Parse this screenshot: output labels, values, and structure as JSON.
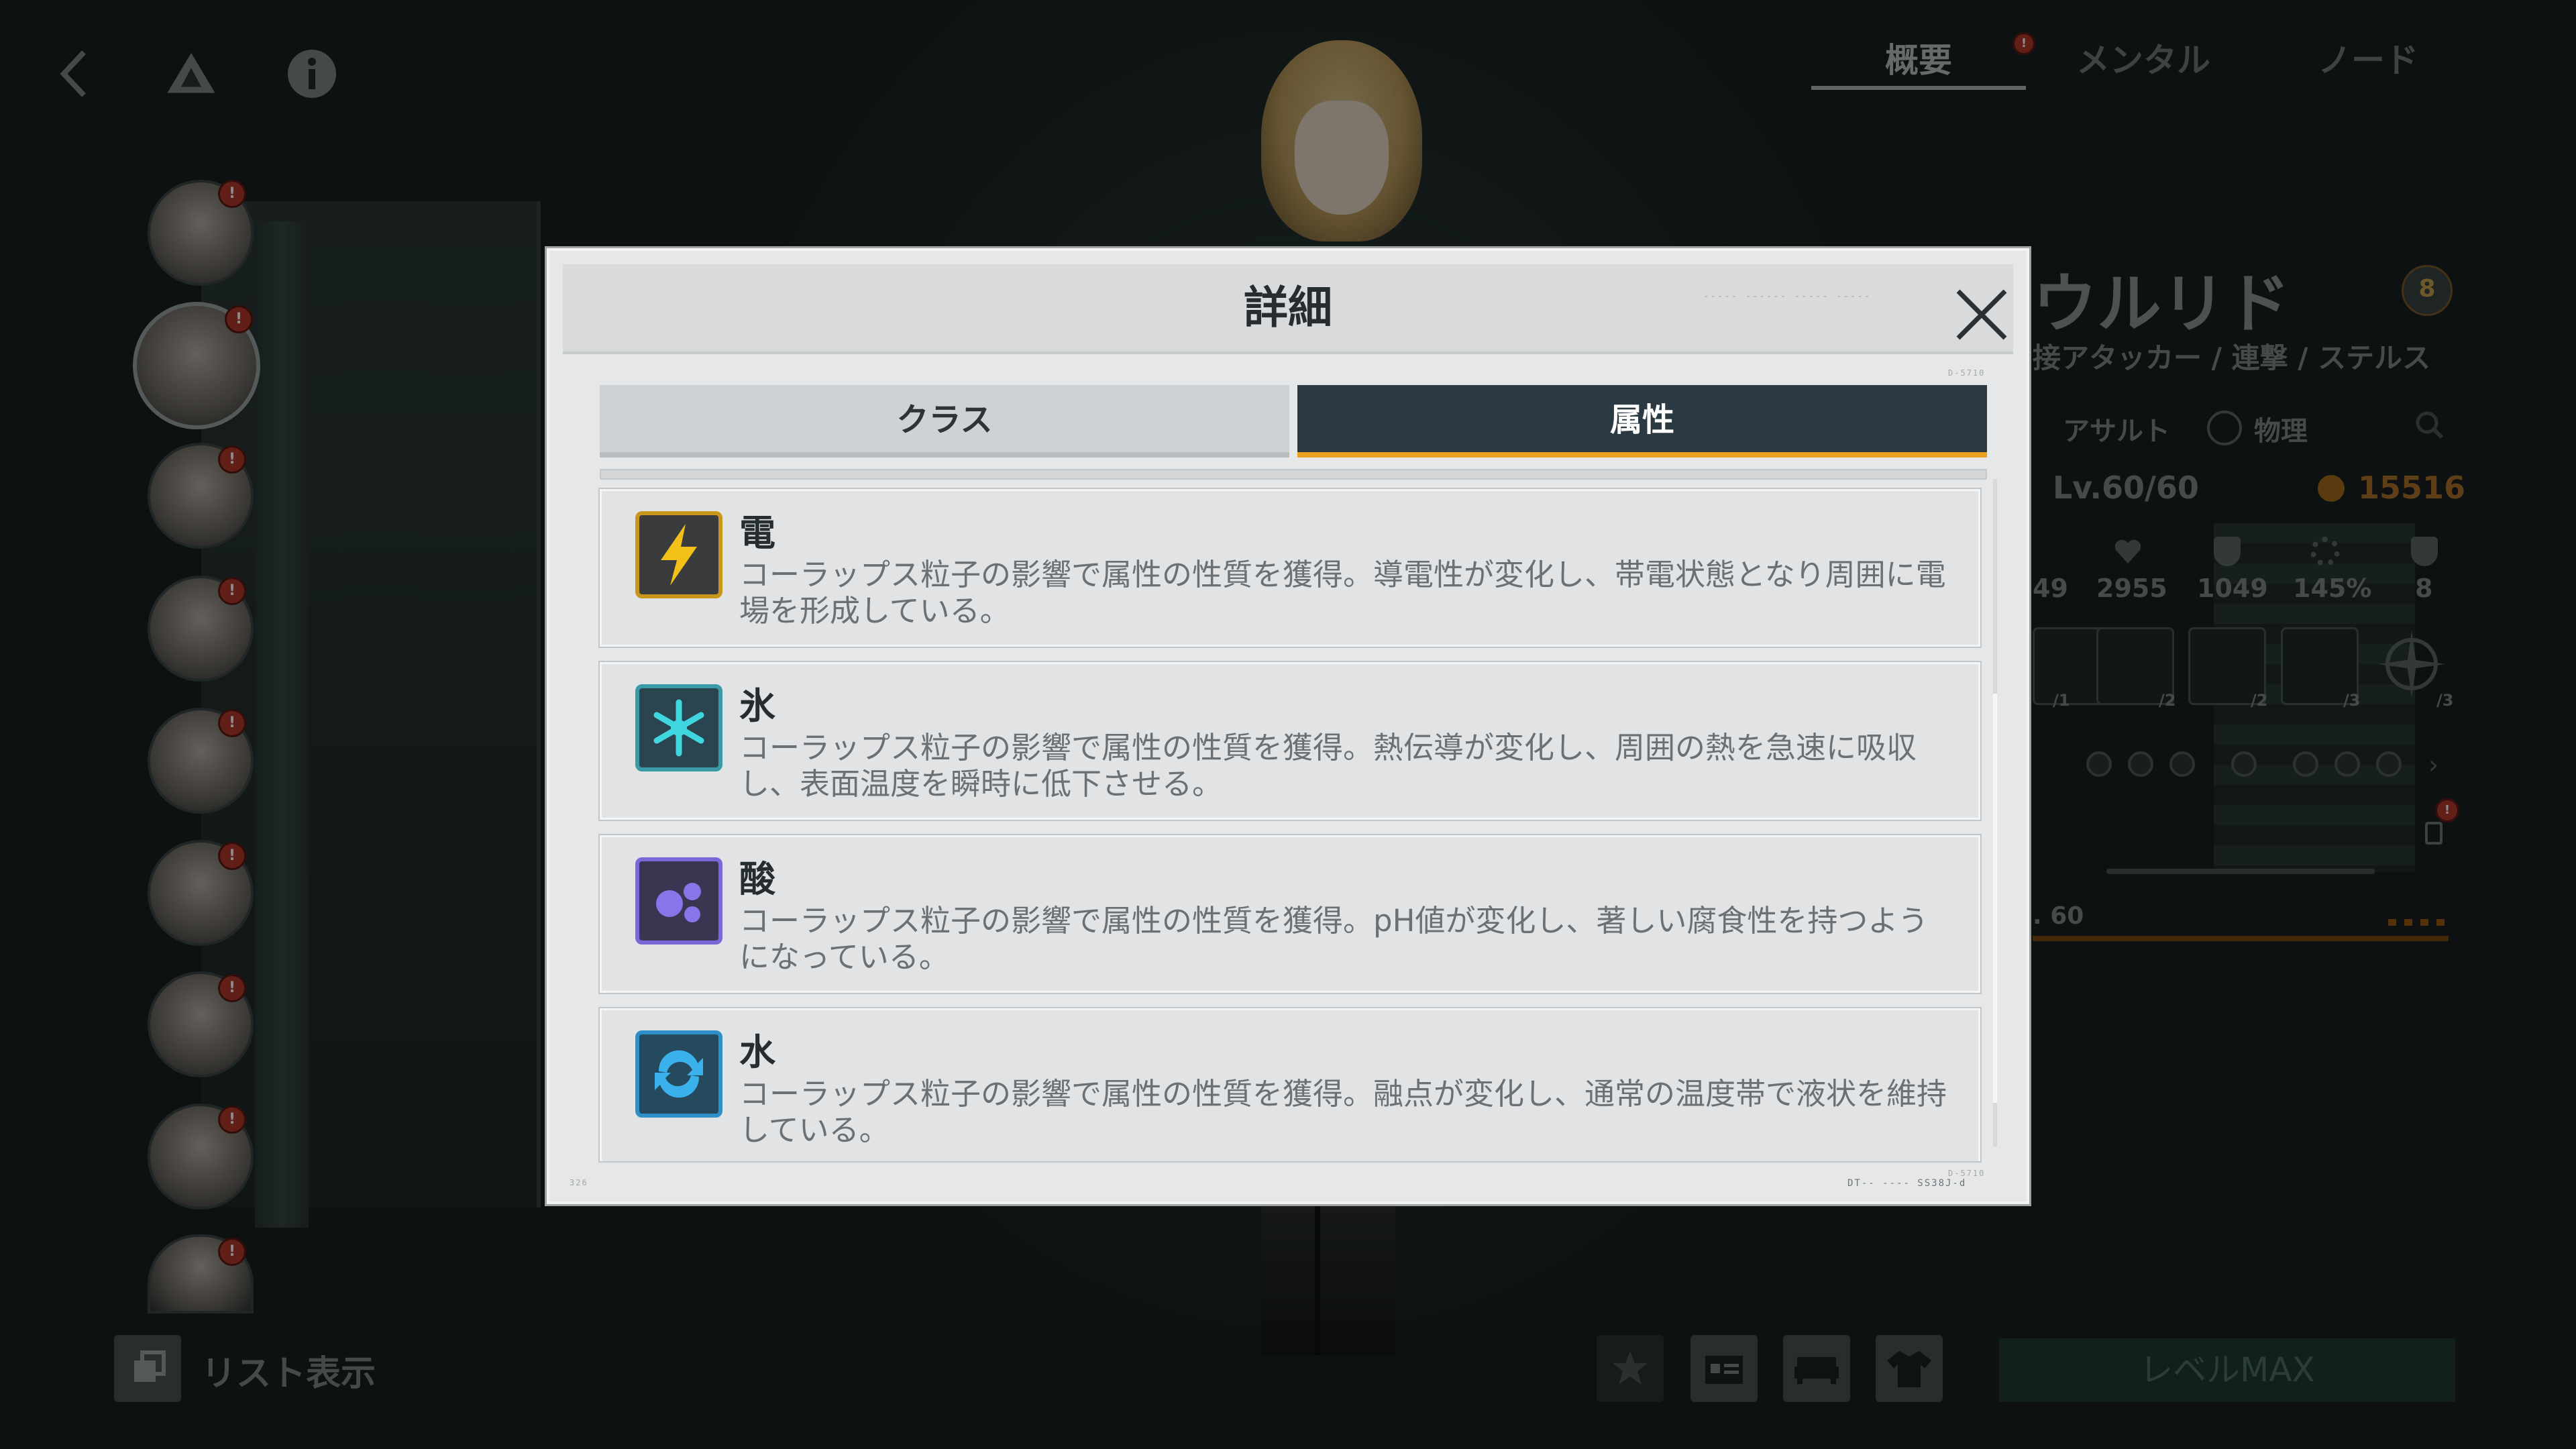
{
  "background": {
    "top_tabs": [
      {
        "label": "概要",
        "active": true,
        "badge": "!"
      },
      {
        "label": "メンタル",
        "active": false
      },
      {
        "label": "ノード",
        "active": false
      }
    ],
    "character": {
      "name_partial": "ウルリド",
      "subtitle_partial": "接アタッカー / 連撃 / ステルス",
      "rank_badge": "8",
      "tag_class": "アサルト",
      "tag_damage": "物理",
      "level": "Lv.60/60",
      "power": "15516",
      "stats": [
        "49",
        "2955",
        "1049",
        "145%",
        "8"
      ],
      "skill_levels": [
        "/1",
        "/2",
        "/2",
        "/3",
        "/3"
      ],
      "weapon_level": ". 60"
    },
    "list_view_label": "リスト表示",
    "level_max_label": "レベルMAX",
    "avatar_badge": "!"
  },
  "modal": {
    "title": "詳細",
    "deco_top": "----- ------ ----- -----",
    "deco_code1": "D-5710",
    "deco_code2": "D-5710",
    "deco_left": "326",
    "deco_bottom": "DT-- ---- SS38J-d",
    "tabs": [
      {
        "label": "クラス",
        "active": false
      },
      {
        "label": "属性",
        "active": true
      }
    ],
    "items": [
      {
        "name": "電",
        "icon": "lightning-icon",
        "icon_color": "#f2c018",
        "icon_bg": "#3a3b3d",
        "desc": "コーラップス粒子の影響で属性の性質を獲得。導電性が変化し、帯電状態となり周囲に電場を形成している。"
      },
      {
        "name": "氷",
        "icon": "snowflake-icon",
        "icon_color": "#3fd6e0",
        "icon_bg": "#2b4550",
        "desc": "コーラップス粒子の影響で属性の性質を獲得。熱伝導が変化し、周囲の熱を急速に吸収し、表面温度を瞬時に低下させる。"
      },
      {
        "name": "酸",
        "icon": "acid-bubbles-icon",
        "icon_color": "#8a74ea",
        "icon_bg": "#3a3652",
        "desc": "コーラップス粒子の影響で属性の性質を獲得。pH値が変化し、著しい腐食性を持つようになっている。"
      },
      {
        "name": "水",
        "icon": "water-swirl-icon",
        "icon_color": "#3bb1ec",
        "icon_bg": "#254a5e",
        "desc": "コーラップス粒子の影響で属性の性質を獲得。融点が変化し、通常の温度帯で液状を維持している。"
      }
    ]
  }
}
